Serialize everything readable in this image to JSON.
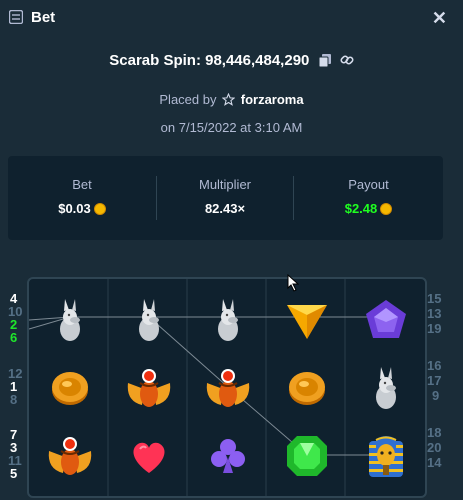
{
  "header": {
    "title": "Bet",
    "icon": "bet-slip-icon",
    "close_label": "✕"
  },
  "bet_info": {
    "game_label": "Scarab Spin: 98,446,484,290",
    "placed_prefix": "Placed by",
    "username": "forzaroma",
    "date": "on 7/15/2022 at 3:10 AM"
  },
  "stats": {
    "bet_label": "Bet",
    "bet_value": "$0.03",
    "multiplier_label": "Multiplier",
    "multiplier_value": "82.43×",
    "payout_label": "Payout",
    "payout_value": "$2.48"
  },
  "colors": {
    "background": "#1a2c38",
    "panel": "#0f212e",
    "muted": "#b1bad3",
    "win_green": "#1fff20"
  },
  "lines": {
    "left_top": [
      "4",
      "10",
      "2",
      "6"
    ],
    "left_mid": [
      "12",
      "1",
      "8"
    ],
    "left_bot": [
      "7",
      "3",
      "11",
      "5"
    ],
    "right_top": [
      "15",
      "13",
      "19"
    ],
    "right_mid": [
      "16",
      "17",
      "9"
    ],
    "right_bot": [
      "18",
      "20",
      "14"
    ]
  },
  "reels": [
    [
      "jackal",
      "jackal",
      "jackal",
      "triangle-gem",
      "pentagon-gem"
    ],
    [
      "gold-coin",
      "scarab",
      "scarab",
      "gold-coin",
      "jackal"
    ],
    [
      "scarab",
      "heart",
      "club",
      "green-gem",
      "pharaoh"
    ]
  ]
}
